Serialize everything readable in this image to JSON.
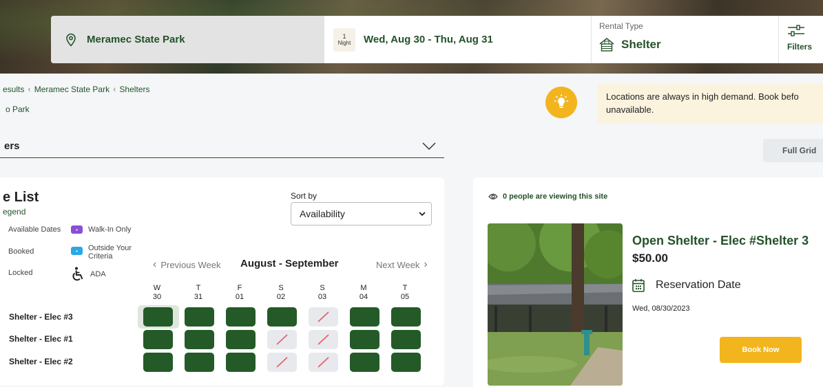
{
  "search": {
    "location": "Meramec State Park",
    "nights_count": "1",
    "nights_label": "Night",
    "dates": "Wed, Aug 30 - Thu, Aug 31",
    "rental_type_label": "Rental Type",
    "rental_type_value": "Shelter",
    "filters_label": "Filters"
  },
  "breadcrumb": {
    "items": [
      "esults",
      "Meramec State Park",
      "Shelters"
    ],
    "back_link": "o Park"
  },
  "tip": {
    "text": "Locations are always in high demand. Book befo unavailable."
  },
  "facility": {
    "selected": "ers",
    "full_grid_label": "Full Grid"
  },
  "site_list": {
    "title": "e List",
    "legend_link": "egend",
    "legend": {
      "available": "Available Dates",
      "booked": "Booked",
      "locked": "Locked",
      "walk_in": "Walk-In Only",
      "outside": "Outside Your Criteria",
      "ada": "ADA"
    },
    "sort_label": "Sort by",
    "sort_value": "Availability",
    "prev_week": "Previous Week",
    "next_week": "Next Week",
    "range": "August - September",
    "days": [
      {
        "dow": "W",
        "date": "30"
      },
      {
        "dow": "T",
        "date": "31"
      },
      {
        "dow": "F",
        "date": "01"
      },
      {
        "dow": "S",
        "date": "02"
      },
      {
        "dow": "S",
        "date": "03"
      },
      {
        "dow": "M",
        "date": "04"
      },
      {
        "dow": "T",
        "date": "05"
      }
    ],
    "rows": [
      {
        "name": "Shelter - Elec #3",
        "cells": [
          "selected",
          "available",
          "available",
          "available",
          "booked",
          "available",
          "available"
        ]
      },
      {
        "name": "Shelter - Elec #1",
        "cells": [
          "available",
          "available",
          "available",
          "booked",
          "booked",
          "available",
          "available"
        ]
      },
      {
        "name": "Shelter - Elec #2",
        "cells": [
          "available",
          "available",
          "available",
          "booked",
          "booked",
          "available",
          "available"
        ]
      }
    ]
  },
  "details": {
    "viewing_text": "0 people are viewing this site",
    "site_name": "Open Shelter - Elec #Shelter 3",
    "price": "$50.00",
    "reservation_label": "Reservation Date",
    "reservation_date": "Wed, 08/30/2023",
    "book_label": "Book Now"
  },
  "colors": {
    "brand_green": "#23522a",
    "available_cell": "#245a28",
    "accent_yellow": "#f2b51e",
    "walk_in_purple": "#8a4fd6",
    "outside_blue": "#2aa8e6"
  }
}
